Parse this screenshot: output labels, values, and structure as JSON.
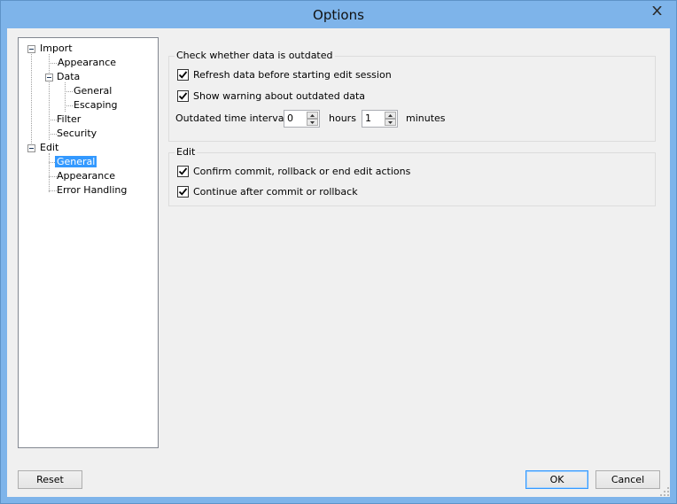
{
  "window": {
    "title": "Options"
  },
  "tree": {
    "import": "Import",
    "import_appearance": "Appearance",
    "data": "Data",
    "data_general": "General",
    "data_escaping": "Escaping",
    "filter": "Filter",
    "security": "Security",
    "edit": "Edit",
    "edit_general": "General",
    "edit_appearance": "Appearance",
    "edit_error_handling": "Error Handling"
  },
  "outdated_group": {
    "title": "Check whether data is outdated",
    "refresh_label": "Refresh data before starting edit session",
    "refresh_checked": true,
    "warning_label": "Show warning about outdated data",
    "warning_checked": true,
    "interval_label": "Outdated time interval:",
    "hours_value": "0",
    "hours_label": "hours",
    "minutes_value": "1",
    "minutes_label": "minutes"
  },
  "edit_group": {
    "title": "Edit",
    "confirm_label": "Confirm commit, rollback or end edit actions",
    "confirm_checked": true,
    "continue_label": "Continue after commit or rollback",
    "continue_checked": true
  },
  "buttons": {
    "reset": "Reset",
    "ok": "OK",
    "cancel": "Cancel"
  },
  "icons": {
    "close": "close-icon",
    "check": "checkmark-icon",
    "spin_up": "arrow-up-icon",
    "spin_down": "arrow-down-icon",
    "resize": "resize-grip-icon"
  },
  "colors": {
    "titlebar": "#7eb4ea",
    "selection": "#3399ff",
    "client_bg": "#f0f0f0"
  }
}
